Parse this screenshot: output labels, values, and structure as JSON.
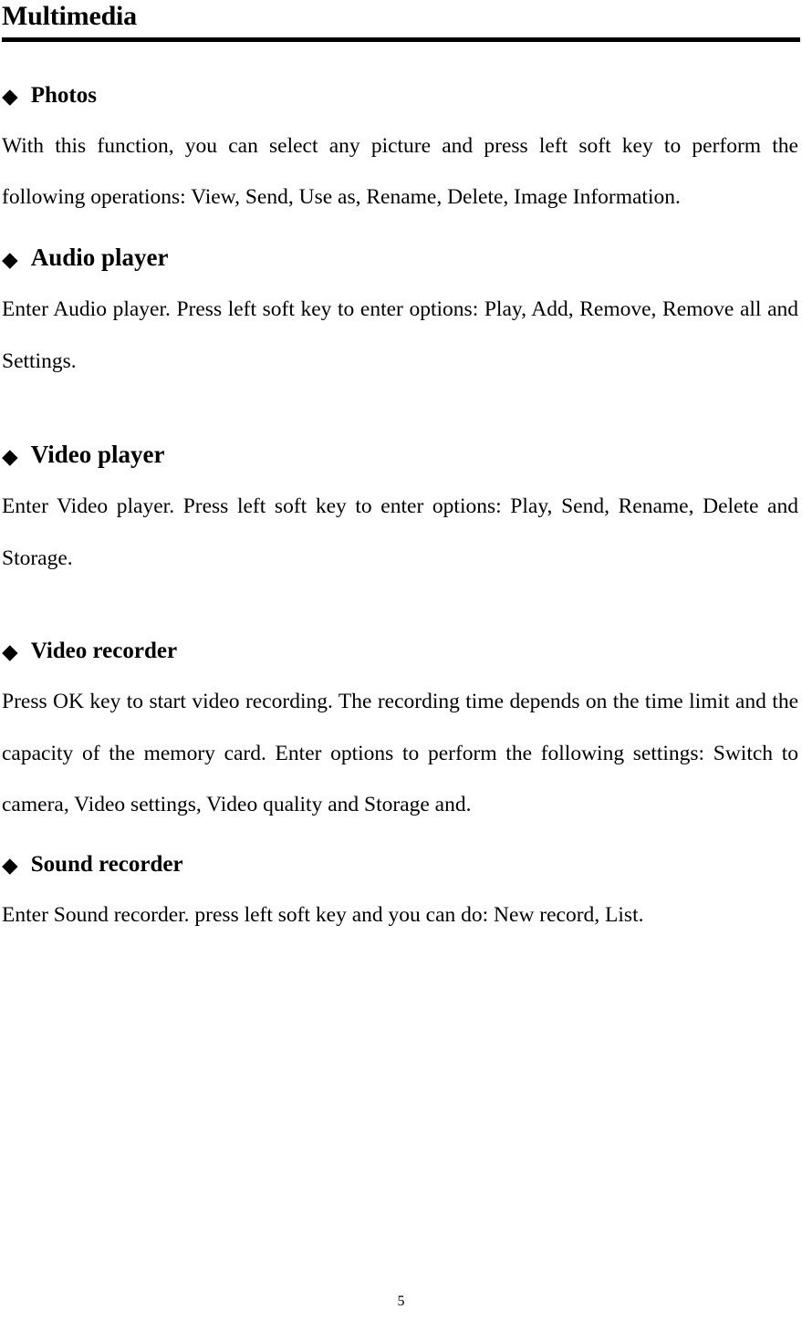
{
  "document": {
    "title": "Multimedia",
    "page_number": "5",
    "bullet_glyph": "◆"
  },
  "sections": [
    {
      "heading": "Photos",
      "body": "With this function, you can select any picture and press left soft key to perform the following operations: View, Send, Use as, Rename, Delete, Image Information."
    },
    {
      "heading": "Audio player",
      "body": "Enter Audio player. Press left soft key to enter options: Play, Add, Remove, Remove all and Settings."
    },
    {
      "heading": "Video player",
      "body": "Enter Video player. Press left soft key to enter options: Play, Send, Rename, Delete and Storage."
    },
    {
      "heading": "Video recorder",
      "body": "Press OK key to start video recording. The recording time depends on the time limit and the capacity of the memory card. Enter options to perform the following settings: Switch to camera, Video settings, Video quality and Storage and."
    },
    {
      "heading": "Sound recorder",
      "body": "Enter Sound recorder. press left soft key and you can do: New record, List."
    }
  ]
}
